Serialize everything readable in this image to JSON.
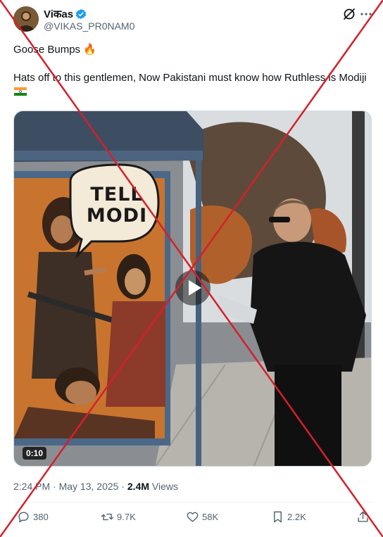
{
  "author": {
    "display_name": "Viकas",
    "handle": "@VIKAS_PR0NAM0"
  },
  "post": {
    "line1": "Goose Bumps 🔥",
    "line2": "Hats off to this gentlemen, Now Pakistani must know how Ruthless is Modiji",
    "flag_icon": "india-flag-icon"
  },
  "media": {
    "poster_text_line1": "TELL",
    "poster_text_line2": "MODI",
    "duration": "0:10",
    "play_icon": "play-icon"
  },
  "meta": {
    "time": "2:24 PM",
    "separator": "·",
    "date": "May 13, 2025",
    "views_count": "2.4M",
    "views_label": "Views"
  },
  "actions": {
    "replies": "380",
    "reposts": "9.7K",
    "likes": "58K",
    "bookmarks": "2.2K"
  },
  "colors": {
    "cross_red": "#d4202b",
    "verified_blue": "#1d9bf0",
    "secondary_text": "#536471"
  }
}
